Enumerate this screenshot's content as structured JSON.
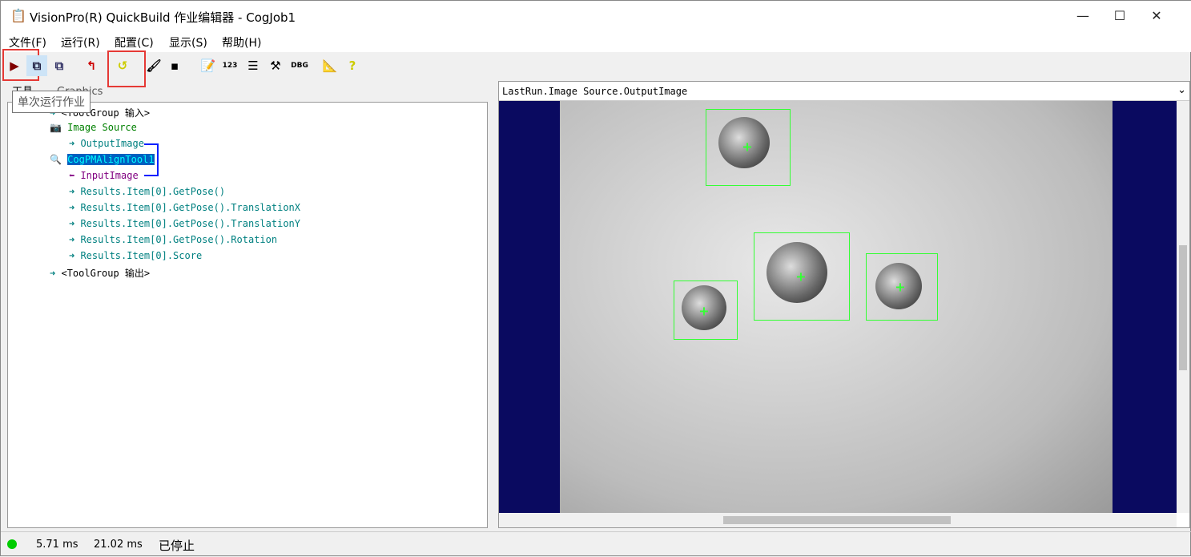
{
  "window": {
    "title": "VisionPro(R) QuickBuild 作业编辑器 - CogJob1",
    "minimize": "—",
    "maximize": "☐",
    "close": "✕"
  },
  "menu": [
    "文件(F)",
    "运行(R)",
    "配置(C)",
    "显示(S)",
    "帮助(H)"
  ],
  "toolbar": {
    "tooltip": "单次运行作业",
    "icons": [
      "run-once",
      "run-continuous",
      "copy",
      "reset",
      "loop",
      "brush",
      "camera",
      "edit",
      "numeric",
      "text",
      "tools",
      "debug",
      "ruler",
      "help"
    ]
  },
  "tabs": [
    "工具",
    "Graphics"
  ],
  "tree": [
    {
      "label": "<ToolGroup 输入>",
      "color": "#000000"
    },
    {
      "label": "Image Source",
      "color": "#008000"
    },
    {
      "label": "OutputImage",
      "color": "#008080"
    },
    {
      "label": "CogPMAlignTool1",
      "color": "#00ffff"
    },
    {
      "label": "InputImage",
      "color": "#800080"
    },
    {
      "label": "Results.Item[0].GetPose()",
      "color": "#008080"
    },
    {
      "label": "Results.Item[0].GetPose().TranslationX",
      "color": "#008080"
    },
    {
      "label": "Results.Item[0].GetPose().TranslationY",
      "color": "#008080"
    },
    {
      "label": "Results.Item[0].GetPose().Rotation",
      "color": "#008080"
    },
    {
      "label": "Results.Item[0].Score",
      "color": "#008080"
    },
    {
      "label": "<ToolGroup 输出>",
      "color": "#000000"
    }
  ],
  "image": {
    "title": "LastRun.Image Source.OutputImage"
  },
  "status": {
    "time1": "5.71 ms",
    "time2": "21.02 ms",
    "state": "已停止",
    "indicator_color": "#00cc00"
  }
}
